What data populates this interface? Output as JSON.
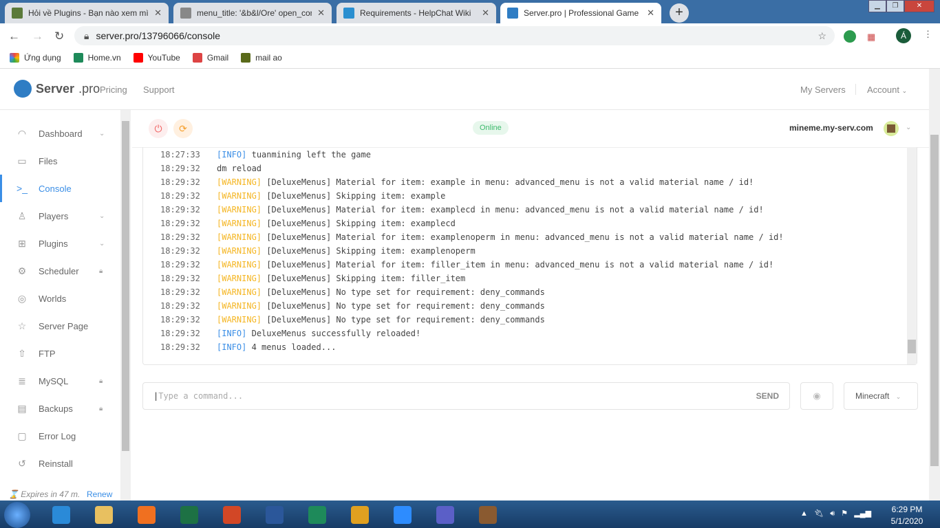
{
  "browser": {
    "tabs": [
      {
        "title": "Hỏi về Plugins - Bạn nào xem mìn",
        "color": "#5b7a3a"
      },
      {
        "title": "menu_title: '&b&l/Ore' open_con",
        "color": "#888888"
      },
      {
        "title": "Requirements - HelpChat Wiki",
        "color": "#2a8fd0"
      },
      {
        "title": "Server.pro | Professional Game Se",
        "color": "#2f7dc4"
      }
    ],
    "url": "server.pro/13796066/console",
    "bookmarks": [
      "Ứng dụng",
      "Home.vn",
      "YouTube",
      "Gmail",
      "mail ao"
    ],
    "profile_initial": "Á"
  },
  "site": {
    "brand": "Server",
    "brand_suffix": ".pro",
    "nav": [
      "Pricing",
      "Support"
    ],
    "right_nav": [
      "My Servers",
      "Account"
    ]
  },
  "sidebar": {
    "items": [
      {
        "label": "Dashboard",
        "icon": "◠"
      },
      {
        "label": "Files",
        "icon": "▭"
      },
      {
        "label": "Console",
        "icon": ">_"
      },
      {
        "label": "Players",
        "icon": "♙"
      },
      {
        "label": "Plugins",
        "icon": "⊞"
      },
      {
        "label": "Scheduler",
        "icon": "⚙"
      },
      {
        "label": "Worlds",
        "icon": "◎"
      },
      {
        "label": "Server Page",
        "icon": "☆"
      },
      {
        "label": "FTP",
        "icon": "⇧"
      },
      {
        "label": "MySQL",
        "icon": "≣"
      },
      {
        "label": "Backups",
        "icon": "▤"
      },
      {
        "label": "Error Log",
        "icon": "▢"
      },
      {
        "label": "Reinstall",
        "icon": "↺"
      }
    ],
    "expires": "Expires in 47 m.",
    "renew": "Renew"
  },
  "server": {
    "status": "Online",
    "hostname": "mineme.my-serv.com"
  },
  "console": {
    "lines": [
      {
        "time": "18:27:33",
        "level": "INFO",
        "text": "tuanmining left the game"
      },
      {
        "time": "18:29:32",
        "level": "",
        "text": "dm reload"
      },
      {
        "time": "18:29:32",
        "level": "WARNING",
        "text": "[DeluxeMenus] Material for item: example in menu: advanced_menu is not a valid material name / id!"
      },
      {
        "time": "18:29:32",
        "level": "WARNING",
        "text": "[DeluxeMenus] Skipping item: example"
      },
      {
        "time": "18:29:32",
        "level": "WARNING",
        "text": "[DeluxeMenus] Material for item: examplecd in menu: advanced_menu is not a valid material name / id!"
      },
      {
        "time": "18:29:32",
        "level": "WARNING",
        "text": "[DeluxeMenus] Skipping item: examplecd"
      },
      {
        "time": "18:29:32",
        "level": "WARNING",
        "text": "[DeluxeMenus] Material for item: examplenoperm in menu: advanced_menu is not a valid material name / id!"
      },
      {
        "time": "18:29:32",
        "level": "WARNING",
        "text": "[DeluxeMenus] Skipping item: examplenoperm"
      },
      {
        "time": "18:29:32",
        "level": "WARNING",
        "text": "[DeluxeMenus] Material for item: filler_item in menu: advanced_menu is not a valid material name / id!"
      },
      {
        "time": "18:29:32",
        "level": "WARNING",
        "text": "[DeluxeMenus] Skipping item: filler_item"
      },
      {
        "time": "18:29:32",
        "level": "WARNING",
        "text": "[DeluxeMenus] No type set for requirement: deny_commands"
      },
      {
        "time": "18:29:32",
        "level": "WARNING",
        "text": "[DeluxeMenus] No type set for requirement: deny_commands"
      },
      {
        "time": "18:29:32",
        "level": "WARNING",
        "text": "[DeluxeMenus] No type set for requirement: deny_commands"
      },
      {
        "time": "18:29:32",
        "level": "INFO",
        "text": "DeluxeMenus successfully reloaded!"
      },
      {
        "time": "18:29:32",
        "level": "INFO",
        "text": "4 menus loaded..."
      }
    ],
    "placeholder": "Type a command...",
    "send": "SEND",
    "game": "Minecraft"
  },
  "taskbar": {
    "time": "6:29 PM",
    "date": "5/1/2020"
  }
}
